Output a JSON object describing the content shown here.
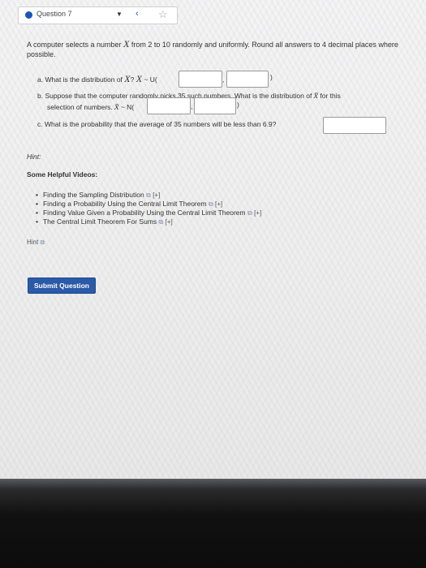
{
  "question_nav": {
    "title": "Question 7",
    "caret": "▼",
    "prev_arrow": "‹",
    "favorite_icon": "☆"
  },
  "prompt": {
    "text_before_var": "A computer selects a number ",
    "var": "X",
    "text_after_var": " from 2 to 10 randomly and uniformly. Round all answers to 4 decimal places where possible."
  },
  "parts": {
    "a": {
      "label": "a.",
      "text": "What is the distribution of ",
      "var_q": "X",
      "q_mark": "?",
      "var": "X",
      "tilde": " ~ U(",
      "sep": ",",
      "close": ")"
    },
    "b": {
      "label": "b.",
      "text": "Suppose that the computer randomly picks 35 such numbers. What is the distribution of ",
      "xbar": "x̄",
      "text_end": " for this",
      "text2": "selection of numbers. ",
      "xbar2": "x̄",
      "tilde": " ~ N(",
      "sep": ",",
      "close": ")"
    },
    "c": {
      "label": "c.",
      "text": "What is the probability that the average of 35 numbers will be less than 6.9?"
    }
  },
  "hint": {
    "title": "Hint:",
    "videos_title": "Some Helpful Videos:",
    "videos": [
      "Finding the Sampling Distribution",
      "Finding a Probability Using the Central Limit Theorem",
      "Finding Value Given a Probability Using the Central Limit Theorem",
      "The Central Limit Theorem For Sums"
    ],
    "ext_icon": "⧉",
    "plus_label": "[+]",
    "hint_link": "Hint",
    "hint_icon": "⧉"
  },
  "submit_label": "Submit Question"
}
